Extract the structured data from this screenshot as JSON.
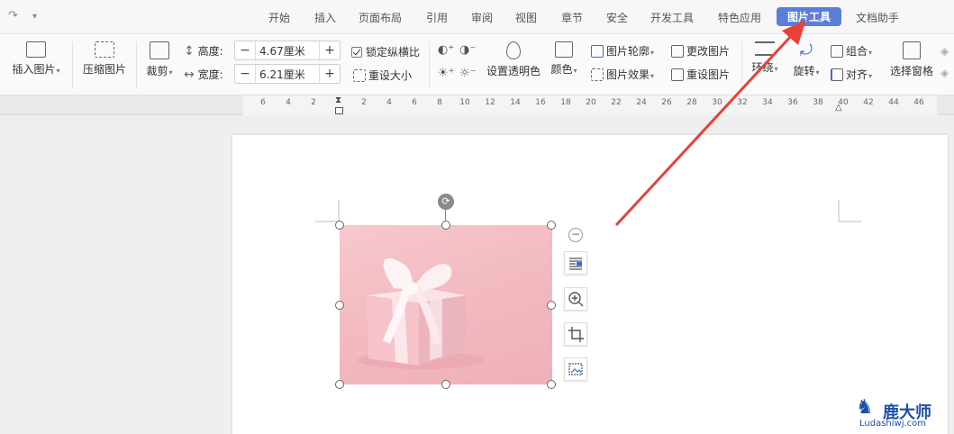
{
  "quick_access": {
    "redo": "↷",
    "more": "▾"
  },
  "tabs": [
    "开始",
    "插入",
    "页面布局",
    "引用",
    "审阅",
    "视图",
    "章节",
    "安全",
    "开发工具",
    "特色应用",
    "图片工具",
    "文档助手"
  ],
  "active_tab": "图片工具",
  "ribbon": {
    "insert_picture": "插入图片",
    "compress_picture": "压缩图片",
    "crop": "裁剪",
    "height_label": "高度:",
    "height_value": "4.67厘米",
    "width_label": "宽度:",
    "width_value": "6.21厘米",
    "lock_ratio": "锁定纵横比",
    "reset_size": "重设大小",
    "set_transparent": "设置透明色",
    "color": "颜色",
    "picture_outline": "图片轮廓",
    "picture_effect": "图片效果",
    "change_picture": "更改图片",
    "reset_picture": "重设图片",
    "wrap": "环绕",
    "rotate": "旋转",
    "group": "组合",
    "align": "对齐",
    "selection_pane": "选择窗格",
    "minus": "−",
    "plus": "+"
  },
  "ruler_ticks": [
    "6",
    "4",
    "2",
    "2",
    "4",
    "6",
    "8",
    "10",
    "12",
    "14",
    "16",
    "18",
    "20",
    "22",
    "24",
    "26",
    "28",
    "30",
    "32",
    "34",
    "36",
    "38",
    "40",
    "42",
    "44",
    "46"
  ],
  "watermark": {
    "brand": "鹿大师",
    "site": "Ludashiwj.com"
  },
  "colors": {
    "active_tab": "#5b7fd8",
    "arrow": "#e8403a",
    "picture_bg": "#f2b8bf"
  }
}
